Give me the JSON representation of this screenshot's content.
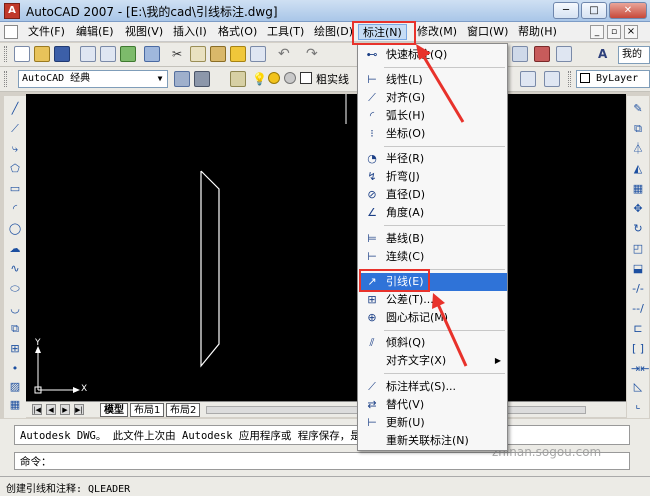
{
  "window": {
    "title": "AutoCAD 2007 - [E:\\我的cad\\引线标注.dwg]",
    "app_icon_letter": "A",
    "controls": {
      "minimize": "─",
      "restore": "□",
      "close": "✕"
    }
  },
  "menubar": {
    "items": [
      "文件(F)",
      "编辑(E)",
      "视图(V)",
      "插入(I)",
      "格式(O)",
      "工具(T)",
      "绘图(D)",
      "标注(N)",
      "修改(M)",
      "窗口(W)",
      "帮助(H)"
    ],
    "right_label": "我的",
    "doc_controls": {
      "minimize": "_",
      "restore": "▫",
      "close": "×"
    }
  },
  "toolbar2": {
    "workspace": "AutoCAD 经典",
    "layer_partial": "粗实线",
    "color": "ByLayer"
  },
  "dropdown": {
    "items": [
      {
        "label": "快速标注(Q)",
        "icon": "quick-dim"
      },
      {
        "label": "线性(L)",
        "icon": "linear"
      },
      {
        "label": "对齐(G)",
        "icon": "aligned"
      },
      {
        "label": "弧长(H)",
        "icon": "arc-length"
      },
      {
        "label": "坐标(O)",
        "icon": "ordinate"
      },
      {
        "label": "半径(R)",
        "icon": "radius"
      },
      {
        "label": "折弯(J)",
        "icon": "jogged"
      },
      {
        "label": "直径(D)",
        "icon": "diameter"
      },
      {
        "label": "角度(A)",
        "icon": "angular"
      },
      {
        "label": "基线(B)",
        "icon": "baseline"
      },
      {
        "label": "连续(C)",
        "icon": "continue"
      },
      {
        "label": "引线(E)",
        "icon": "leader"
      },
      {
        "label": "公差(T)...",
        "icon": "tolerance"
      },
      {
        "label": "圆心标记(M)",
        "icon": "center-mark"
      },
      {
        "label": "倾斜(Q)",
        "icon": "oblique"
      },
      {
        "label": "对齐文字(X)",
        "icon": ""
      },
      {
        "label": "标注样式(S)...",
        "icon": "dim-style"
      },
      {
        "label": "替代(V)",
        "icon": "override"
      },
      {
        "label": "更新(U)",
        "icon": "update"
      },
      {
        "label": "重新关联标注(N)",
        "icon": ""
      }
    ]
  },
  "layout_tabs": [
    "模型",
    "布局1",
    "布局2"
  ],
  "command": {
    "history": "Autodesk DWG。  此文件上次由 Autodesk 应用程序或          程序保存，是可靠的",
    "prompt": "命令："
  },
  "status": {
    "text": "创建引线和注释:  QLEADER"
  },
  "ucs": {
    "x_label": "X",
    "y_label": "Y"
  },
  "colors": {
    "highlight": "#2f73d8",
    "annotation": "#e8322b",
    "canvas": "#000000"
  },
  "watermark": "zhinan.sogou.com"
}
